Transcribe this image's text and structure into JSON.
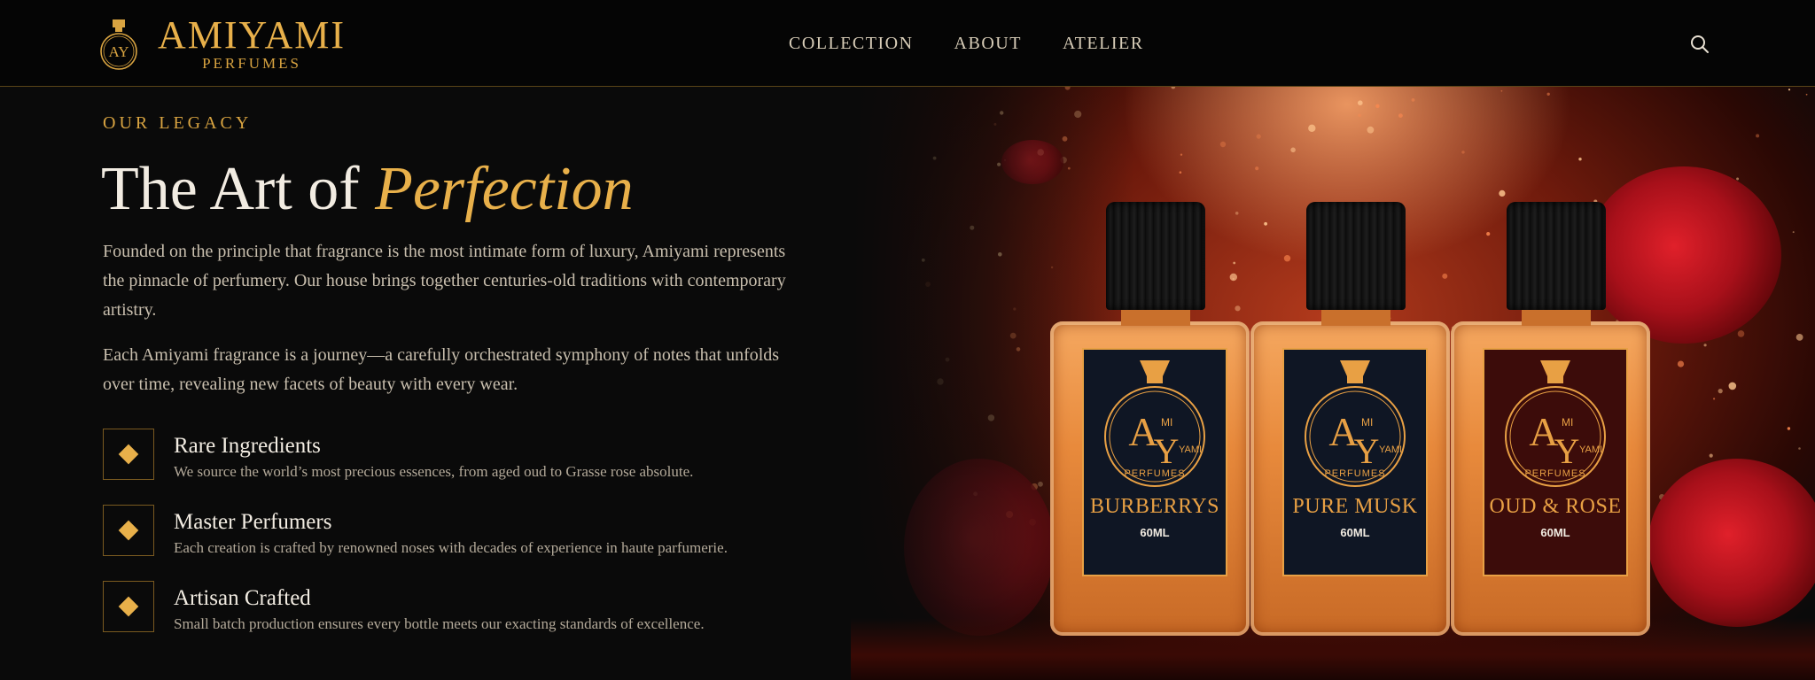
{
  "header": {
    "brand": "AMIYAMI",
    "brand_sub": "PERFUMES",
    "logo_monogram": "AY",
    "logo_icon": "perfume-bottle-monogram-icon",
    "nav": [
      {
        "label": "COLLECTION"
      },
      {
        "label": "ABOUT"
      },
      {
        "label": "ATELIER"
      }
    ],
    "search_icon": "search-icon"
  },
  "hero": {
    "eyebrow": "OUR LEGACY",
    "headline_prefix": "The Art of ",
    "headline_accent": "Perfection",
    "paragraph_1": "Founded on the principle that fragrance is the most intimate form of luxury, Amiyami represents the pinnacle of perfumery. Our house brings together centuries-old traditions with contemporary artistry.",
    "paragraph_2": "Each Amiyami fragrance is a journey—a carefully orchestrated symphony of notes that unfolds over time, revealing new facets of beauty with every wear."
  },
  "features": [
    {
      "icon": "diamond-icon",
      "title": "Rare Ingredients",
      "description": "We source the world’s most precious essences, from aged oud to Grasse rose absolute."
    },
    {
      "icon": "diamond-icon",
      "title": "Master Perfumers",
      "description": "Each creation is crafted by renowned noses with decades of experience in haute parfumerie."
    },
    {
      "icon": "diamond-icon",
      "title": "Artisan Crafted",
      "description": "Small batch production ensures every bottle meets our exacting standards of excellence."
    }
  ],
  "products": [
    {
      "name": "BURBERRYS",
      "size": "60ML",
      "label_style": "navy",
      "emblem_a": "A",
      "emblem_y": "Y",
      "emblem_mi": "MI",
      "emblem_yami": "YAMI",
      "emblem_text": "PERFUMES"
    },
    {
      "name": "PURE MUSK",
      "size": "60ML",
      "label_style": "navy",
      "emblem_a": "A",
      "emblem_y": "Y",
      "emblem_mi": "MI",
      "emblem_yami": "YAMI",
      "emblem_text": "PERFUMES"
    },
    {
      "name": "OUD & ROSE",
      "size": "60ML",
      "label_style": "burgundy",
      "emblem_a": "A",
      "emblem_y": "Y",
      "emblem_mi": "MI",
      "emblem_yami": "YAMI",
      "emblem_text": "PERFUMES"
    }
  ],
  "colors": {
    "background": "#0a0a0a",
    "gold": "#e8b04a",
    "cream": "#f2ece2",
    "body_text": "#c9bfae"
  }
}
